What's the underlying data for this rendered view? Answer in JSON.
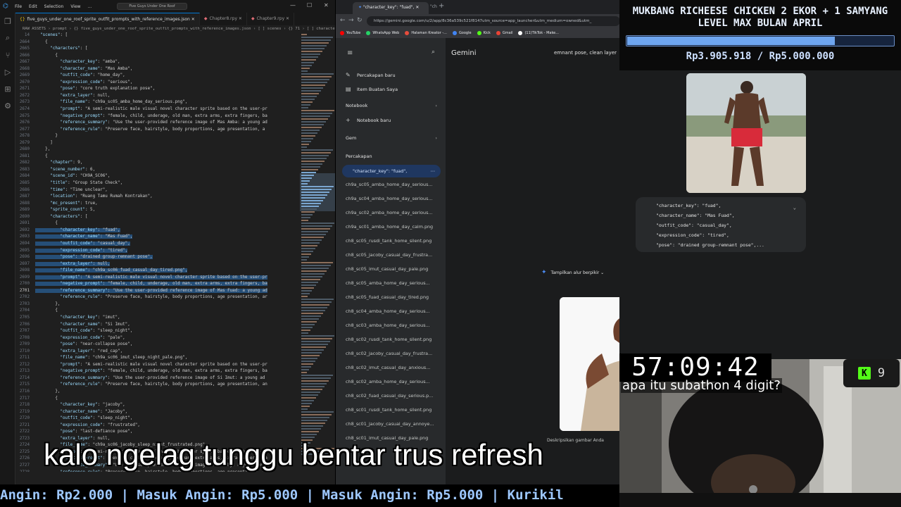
{
  "vscode": {
    "logo": "⌬",
    "menu": [
      "File",
      "Edit",
      "Selection",
      "View",
      "..."
    ],
    "window_title": "Five Guys Under One Roof",
    "tabs": [
      {
        "label": "five_guys_under_one_roof_sprite_outfit_prompts_with_reference_images.json",
        "close": "✕"
      },
      {
        "label": "Chapter8.rpy",
        "close": "✕"
      },
      {
        "label": "Chapter9.rpy",
        "close": "✕"
      }
    ],
    "breadcrumb": "RAW ASSETS › prompt › {} five_guys_under_one_roof_sprite_outfit_prompts_with_reference_images.json › [ ] scenes › {} 71 › [ ] characters › {} 0",
    "lines": [
      {
        "n": "14",
        "t": "  \"scenes\": ["
      },
      {
        "n": "2664",
        "t": "    {"
      },
      {
        "n": "2665",
        "t": "      \"characters\": ["
      },
      {
        "n": "2666",
        "t": "        {"
      },
      {
        "n": "2667",
        "t": "          \"character_key\": \"amba\","
      },
      {
        "n": "2668",
        "t": "          \"character_name\": \"Mas Amba\","
      },
      {
        "n": "2669",
        "t": "          \"outfit_code\": \"home_day\","
      },
      {
        "n": "2670",
        "t": "          \"expression_code\": \"serious\","
      },
      {
        "n": "2671",
        "t": "          \"pose\": \"core truth explanation pose\","
      },
      {
        "n": "2672",
        "t": "          \"extra_layer\": null,"
      },
      {
        "n": "2673",
        "t": "          \"file_name\": \"ch9a_sc05_amba_home_day_serious.png\","
      },
      {
        "n": "2674",
        "t": "          \"prompt\": \"A semi-realistic male visual novel character sprite based on the user-pr"
      },
      {
        "n": "2675",
        "t": "          \"negative_prompt\": \"female, child, underage, old man, extra arms, extra fingers, ba"
      },
      {
        "n": "2676",
        "t": "          \"reference_summary\": \"Use the user-provided reference image of Mas Amba: a young ad"
      },
      {
        "n": "2677",
        "t": "          \"reference_rule\": \"Preserve face, hairstyle, body proportions, age presentation, a"
      },
      {
        "n": "2678",
        "t": "        }"
      },
      {
        "n": "2679",
        "t": "      ]"
      },
      {
        "n": "2680",
        "t": "    },"
      },
      {
        "n": "2681",
        "t": "    {"
      },
      {
        "n": "2682",
        "t": "      \"chapter\": 9,"
      },
      {
        "n": "2683",
        "t": "      \"scene_number\": 6,"
      },
      {
        "n": "2684",
        "t": "      \"scene_id\": \"CH9A_SC06\","
      },
      {
        "n": "2685",
        "t": "      \"title\": \"Group State Check\","
      },
      {
        "n": "2686",
        "t": "      \"time\": \"Time unclear\","
      },
      {
        "n": "2687",
        "t": "      \"location\": \"Ruang Tamu Rumah Kontrakan\","
      },
      {
        "n": "2688",
        "t": "      \"mc_present\": true,"
      },
      {
        "n": "2689",
        "t": "      \"sprite_count\": 5,"
      },
      {
        "n": "2690",
        "t": "      \"characters\": ["
      },
      {
        "n": "2691",
        "t": "        {"
      },
      {
        "n": "2692",
        "t": "          \"character_key\": \"fuad\","
      },
      {
        "n": "2693",
        "t": "          \"character_name\": \"Mas Fuad\","
      },
      {
        "n": "2694",
        "t": "          \"outfit_code\": \"casual_day\","
      },
      {
        "n": "2695",
        "t": "          \"expression_code\": \"tired\","
      },
      {
        "n": "2696",
        "t": "          \"pose\": \"drained group-remnant pose\","
      },
      {
        "n": "2697",
        "t": "          \"extra_layer\": null,"
      },
      {
        "n": "2698",
        "t": "          \"file_name\": \"ch9a_sc06_fuad_casual_day_tired.png\","
      },
      {
        "n": "2699",
        "t": "          \"prompt\": \"A semi-realistic male visual novel character sprite based on the user-pr"
      },
      {
        "n": "2700",
        "t": "          \"negative_prompt\": \"female, child, underage, old man, extra arms, extra fingers, ba"
      },
      {
        "n": "2701",
        "t": "          \"reference_summary\": \"Use the user-provided reference image of Mas Fuad: a young ad"
      },
      {
        "n": "2702",
        "t": "          \"reference_rule\": \"Preserve face, hairstyle, body proportions, age presentation, ar"
      },
      {
        "n": "2703",
        "t": "        },"
      },
      {
        "n": "2704",
        "t": "        {"
      },
      {
        "n": "2705",
        "t": "          \"character_key\": \"imut\","
      },
      {
        "n": "2706",
        "t": "          \"character_name\": \"Si Imut\","
      },
      {
        "n": "2707",
        "t": "          \"outfit_code\": \"sleep_night\","
      },
      {
        "n": "2708",
        "t": "          \"expression_code\": \"pale\","
      },
      {
        "n": "2709",
        "t": "          \"pose\": \"near-collapse pose\","
      },
      {
        "n": "2710",
        "t": "          \"extra_layer\": \"red_cap\","
      },
      {
        "n": "2711",
        "t": "          \"file_name\": \"ch9a_sc06_imut_sleep_night_pale.png\","
      },
      {
        "n": "2712",
        "t": "          \"prompt\": \"A semi-realistic male visual novel character sprite based on the user-pr"
      },
      {
        "n": "2713",
        "t": "          \"negative_prompt\": \"female, child, underage, old man, extra arms, extra fingers, ba"
      },
      {
        "n": "2714",
        "t": "          \"reference_summary\": \"Use the user-provided reference image of Si Imut: a young ad"
      },
      {
        "n": "2715",
        "t": "          \"reference_rule\": \"Preserve face, hairstyle, body proportions, age presentation, an"
      },
      {
        "n": "2716",
        "t": "        },"
      },
      {
        "n": "2717",
        "t": "        {"
      },
      {
        "n": "2718",
        "t": "          \"character_key\": \"jacoby\","
      },
      {
        "n": "2719",
        "t": "          \"character_name\": \"Jacoby\","
      },
      {
        "n": "2720",
        "t": "          \"outfit_code\": \"sleep_night\","
      },
      {
        "n": "2721",
        "t": "          \"expression_code\": \"frustrated\","
      },
      {
        "n": "2722",
        "t": "          \"pose\": \"last-defiance pose\","
      },
      {
        "n": "2723",
        "t": "          \"extra_layer\": null,"
      },
      {
        "n": "2724",
        "t": "          \"file_name\": \"ch9a_sc06_jacoby_sleep_night_frustrated.png\","
      },
      {
        "n": "2725",
        "t": "          \"prompt\": \"A semi-realistic male visual novel character sprite based on the user-pr"
      },
      {
        "n": "2726",
        "t": "          \"negative_prompt\": \"female, child, underage, old man, extra arms, extra fingers, ba"
      },
      {
        "n": "2727",
        "t": "          \"reference_summary\": \"Use the user-provided reference image of Jacoby: a young adu"
      },
      {
        "n": "2728",
        "t": "          \"reference_rule\": \"Preserve face, hairstyle, body proportions, age presentation, an"
      }
    ]
  },
  "browser": {
    "tab_title": "\"character_key\": \"fuad\",",
    "tab_close": "✕",
    "tab2_title": "\"ch",
    "new_tab": "+",
    "url": "https://gemini.google.com/u/2/app/8c36a539c521f8147utm_source=app_launcher&utm_medium=owned&utm_",
    "bookmarks": [
      {
        "label": "YouTube",
        "color": "#ff0000"
      },
      {
        "label": "WhatsApp Web",
        "color": "#25d366"
      },
      {
        "label": "Halaman Kreator -...",
        "color": "#e74c3c"
      },
      {
        "label": "Google",
        "color": "#4285f4"
      },
      {
        "label": "Kick",
        "color": "#53fc18"
      },
      {
        "label": "Gmail",
        "color": "#ea4335"
      },
      {
        "label": "(11)TikTok - Make...",
        "color": "#ffffff"
      }
    ]
  },
  "gemini": {
    "brand": "Gemini",
    "chat_title": "emnant pose, clean layer",
    "new_chat": "Percakapan baru",
    "my_items": "Item Buatan Saya",
    "notebook_section": "Notebook",
    "new_notebook": "Notebook baru",
    "gem_section": "Gem",
    "chats_section": "Percakapan",
    "active_chat": "\"character_key\": \"fuad\",",
    "chats": [
      "ch9a_sc05_amba_home_day_serious...",
      "ch9a_sc04_amba_home_day_serious...",
      "ch9a_sc02_amba_home_day_serious...",
      "ch9a_sc01_amba_home_day_calm.png",
      "ch8_sc05_rusdi_tank_home_silent.png",
      "ch8_sc05_jacoby_casual_day_frustra...",
      "ch8_sc05_imut_casual_day_pale.png",
      "ch8_sc05_amba_home_day_serious...",
      "ch8_sc05_fuad_casual_day_tired.png",
      "ch8_sc04_amba_home_day_serious...",
      "ch8_sc03_amba_home_day_serious...",
      "ch8_sc02_rusdi_tank_home_silent.png",
      "ch8_sc02_jacoby_casual_day_frustra...",
      "ch8_sc02_imut_casual_day_anxious...",
      "ch8_sc02_amba_home_day_serious...",
      "ch8_sc02_fuad_casual_day_serious.p...",
      "ch8_sc01_rusdi_tank_home_silent.png",
      "ch8_sc01_jacoby_casual_day_annoye...",
      "ch8_sc01_imut_casual_day_pale.png"
    ],
    "user_message": [
      "\"character_key\": \"fuad\",",
      "\"character_name\": \"Mas Fuad\",",
      "\"outfit_code\": \"casual_day\",",
      "\"expression_code\": \"tired\",",
      "\"pose\": \"drained group-remnant pose\",..."
    ],
    "show_thinking": "Tampilkan alur berpikir",
    "image_caption": "Deskripsikan gambar Anda"
  },
  "stream": {
    "goal_title": "MUKBANG RICHEESE CHICKEN 2 EKOR + 1 SAMYANG LEVEL MAX BULAN APRIL",
    "goal_progress": 0.781,
    "goal_text": "Rp3.905.918 / Rp5.000.000",
    "timer": "57:09:42",
    "chat_message": "apa itu subathon 4 digit?",
    "kick_logo": "K",
    "viewer_count": "9",
    "subtitle": "kalo ngelag tunggu bentar trus refresh",
    "ticker": "Angin: Rp2.000 | Masuk Angin: Rp5.000 | Masuk Angin: Rp5.000 | Kurikil",
    "accent": "#6ea5ef"
  }
}
